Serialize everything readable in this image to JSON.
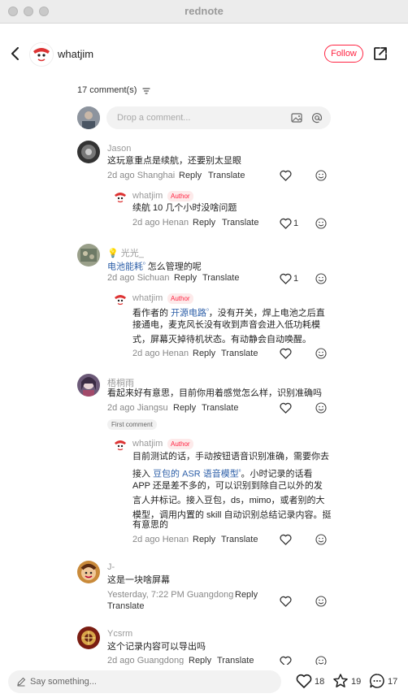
{
  "window": {
    "title": "rednote"
  },
  "header": {
    "author_name": "whatjim",
    "follow_label": "Follow"
  },
  "comments_header": {
    "count_label": "17 comment(s)"
  },
  "composer": {
    "placeholder": "Drop a comment..."
  },
  "comments": [
    {
      "user": "Jason",
      "text": "这玩意重点是续航，还要别太显眼",
      "meta": "2d ago Shanghai",
      "reply_label": "Reply",
      "translate_label": "Translate",
      "reply": {
        "user": "whatjim",
        "badge": "Author",
        "text": "续航 10 几个小时没啥问题",
        "meta": "2d ago Henan",
        "reply_label": "Reply",
        "translate_label": "Translate",
        "likes": "1"
      }
    },
    {
      "user": "光光_",
      "text_link": "电池能耗",
      "text_rest": " 怎么管理的呢",
      "meta": "2d ago Sichuan",
      "reply_label": "Reply",
      "translate_label": "Translate",
      "likes": "1",
      "reply": {
        "user": "whatjim",
        "badge": "Author",
        "text_pre": "看作者的 ",
        "text_link": "开源电路",
        "text_rest1": "，没有开关，焊上电池之后直",
        "line2": "接通电，麦克风长没有收到声音会进入低功耗模",
        "line3": "式，屏幕灭掉待机状态。有动静会自动唤醒。",
        "meta": "2d ago Henan",
        "reply_label": "Reply",
        "translate_label": "Translate"
      }
    },
    {
      "user": "梧桐雨",
      "text": "看起来好有意思，目前你用着感觉怎么样，识别准确吗",
      "meta": "2d ago Jiangsu",
      "reply_label": "Reply",
      "translate_label": "Translate",
      "first_comment": "First comment",
      "reply": {
        "user": "whatjim",
        "badge": "Author",
        "line1": "目前测试的话，手动按钮语音识别准确，需要你去",
        "line2_pre": "接入 ",
        "line2_link": "豆包的 ASR 语音模型",
        "line2_rest": "。小时记录的话看",
        "line3": "APP 还是差不多的，可以识别到除自己以外的发",
        "line4": "言人并标记。接入豆包，ds，mimo，或者别的大",
        "line5": "模型，调用内置的 skill 自动识别总结记录内容。挺",
        "line6": "有意思的",
        "meta": "2d ago Henan",
        "reply_label": "Reply",
        "translate_label": "Translate"
      }
    },
    {
      "user": "J-",
      "text": "这是一块啥屏幕",
      "meta": "Yesterday, 7:22 PM Guangdong",
      "reply_label": "Reply",
      "translate_label": "Translate"
    },
    {
      "user": "Ycsrm",
      "text": "这个记录内容可以导出吗",
      "meta": "2d ago Guangdong",
      "reply_label": "Reply",
      "translate_label": "Translate"
    }
  ],
  "bottom_bar": {
    "placeholder": "Say something...",
    "likes": "18",
    "collects": "19",
    "comments": "17"
  },
  "colors": {
    "accent": "#ff2442",
    "link": "#2d5fa8"
  }
}
